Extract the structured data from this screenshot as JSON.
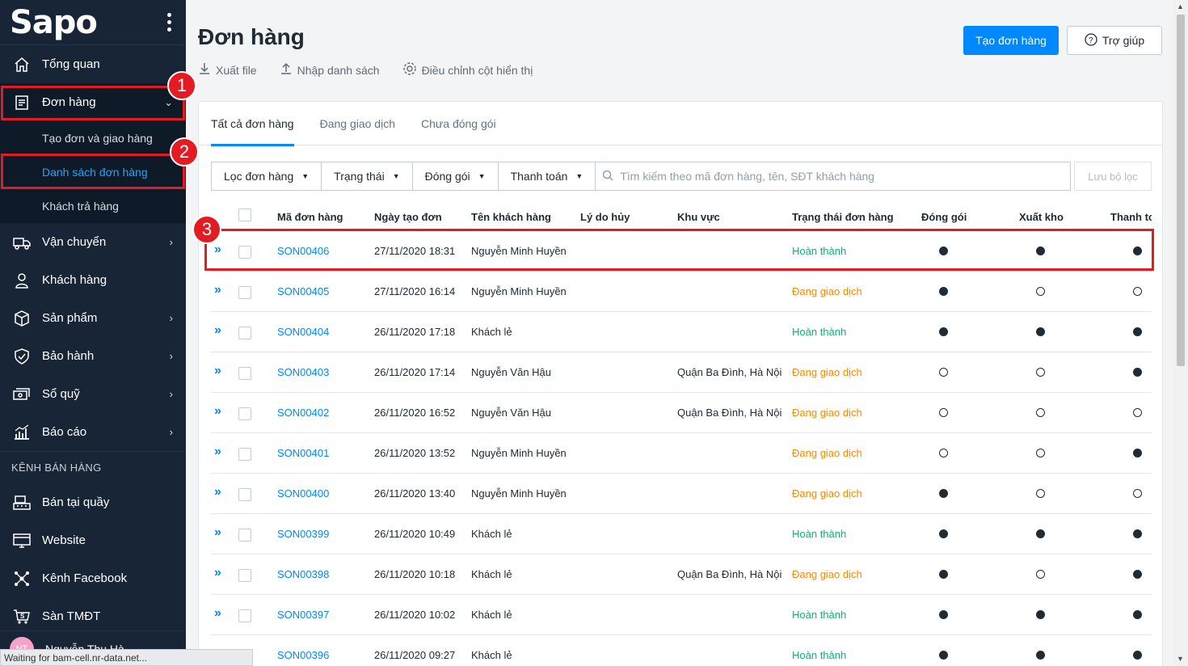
{
  "sidebar": {
    "logo": "Sapo",
    "items": [
      {
        "label": "Tổng quan",
        "icon": "home-icon",
        "chevron": ""
      },
      {
        "label": "Đơn hàng",
        "icon": "order-icon",
        "chevron": "⌄"
      },
      {
        "label": "Vận chuyển",
        "icon": "truck-icon",
        "chevron": "›"
      },
      {
        "label": "Khách hàng",
        "icon": "user-icon",
        "chevron": ""
      },
      {
        "label": "Sản phẩm",
        "icon": "box-icon",
        "chevron": "›"
      },
      {
        "label": "Bảo hành",
        "icon": "shield-icon",
        "chevron": "›"
      },
      {
        "label": "Sổ quỹ",
        "icon": "cash-icon",
        "chevron": "›"
      },
      {
        "label": "Báo cáo",
        "icon": "chart-icon",
        "chevron": "›"
      }
    ],
    "sub_items": [
      "Tạo đơn và giao hàng",
      "Danh sách đơn hàng",
      "Khách trả hàng"
    ],
    "channels_title": "KÊNH BÁN HÀNG",
    "channels": [
      {
        "label": "Bán tại quầy",
        "icon": "pos-icon"
      },
      {
        "label": "Website",
        "icon": "website-icon"
      },
      {
        "label": "Kênh Facebook",
        "icon": "facebook-icon"
      },
      {
        "label": "Sàn TMĐT",
        "icon": "marketplace-icon"
      }
    ],
    "user": {
      "initials": "NT",
      "name": "Nguyễn Thu Hà"
    }
  },
  "status_bar": "Waiting for bam-cell.nr-data.net...",
  "header": {
    "title": "Đơn hàng",
    "actions": [
      "Xuất file",
      "Nhập danh sách",
      "Điều chỉnh cột hiển thị"
    ],
    "create_button": "Tạo đơn hàng",
    "help_button": "Trợ giúp"
  },
  "tabs": [
    "Tất cả đơn hàng",
    "Đang giao dịch",
    "Chưa đóng gói"
  ],
  "filters": {
    "buttons": [
      "Lọc đơn hàng",
      "Trạng thái",
      "Đóng gói",
      "Thanh toán"
    ],
    "search_placeholder": "Tìm kiếm theo mã đơn hàng, tên, SĐT khách hàng",
    "save_filter": "Lưu bộ lọc"
  },
  "table": {
    "columns": [
      "Mã đơn hàng",
      "Ngày tạo đơn",
      "Tên khách hàng",
      "Lý do hủy",
      "Khu vực",
      "Trạng thái đơn hàng",
      "Đóng gói",
      "Xuất kho",
      "Thanh to"
    ],
    "rows": [
      {
        "code": "SON00406",
        "date": "27/11/2020 18:31",
        "customer": "Nguyễn Minh Huyền",
        "area": "",
        "status": "Hoàn thành",
        "packed": true,
        "exported": true,
        "paid": true
      },
      {
        "code": "SON00405",
        "date": "27/11/2020 16:14",
        "customer": "Nguyễn Minh Huyền",
        "area": "",
        "status": "Đang giao dịch",
        "packed": true,
        "exported": false,
        "paid": false
      },
      {
        "code": "SON00404",
        "date": "26/11/2020 17:18",
        "customer": "Khách lẻ",
        "area": "",
        "status": "Hoàn thành",
        "packed": true,
        "exported": true,
        "paid": true
      },
      {
        "code": "SON00403",
        "date": "26/11/2020 17:14",
        "customer": "Nguyễn Văn Hậu",
        "area": "Quận Ba Đình, Hà Nội",
        "status": "Đang giao dịch",
        "packed": false,
        "exported": false,
        "paid": true
      },
      {
        "code": "SON00402",
        "date": "26/11/2020 16:52",
        "customer": "Nguyễn Văn Hậu",
        "area": "Quận Ba Đình, Hà Nội",
        "status": "Đang giao dịch",
        "packed": false,
        "exported": false,
        "paid": false
      },
      {
        "code": "SON00401",
        "date": "26/11/2020 13:52",
        "customer": "Nguyễn Minh Huyền",
        "area": "",
        "status": "Đang giao dịch",
        "packed": false,
        "exported": false,
        "paid": true
      },
      {
        "code": "SON00400",
        "date": "26/11/2020 13:40",
        "customer": "Nguyễn Minh Huyền",
        "area": "",
        "status": "Đang giao dịch",
        "packed": true,
        "exported": false,
        "paid": false
      },
      {
        "code": "SON00399",
        "date": "26/11/2020 10:49",
        "customer": "Khách lẻ",
        "area": "",
        "status": "Hoàn thành",
        "packed": true,
        "exported": true,
        "paid": true
      },
      {
        "code": "SON00398",
        "date": "26/11/2020 10:18",
        "customer": "Khách lẻ",
        "area": "Quận Ba Đình, Hà Nội",
        "status": "Đang giao dịch",
        "packed": true,
        "exported": false,
        "paid": true
      },
      {
        "code": "SON00397",
        "date": "26/11/2020 10:02",
        "customer": "Khách lẻ",
        "area": "",
        "status": "Hoàn thành",
        "packed": true,
        "exported": true,
        "paid": true
      },
      {
        "code": "SON00396",
        "date": "26/11/2020 09:27",
        "customer": "Khách lẻ",
        "area": "",
        "status": "Hoàn thành",
        "packed": true,
        "exported": true,
        "paid": true
      }
    ]
  },
  "annotations": [
    "1",
    "2",
    "3"
  ],
  "colors": {
    "accent": "#0088ff",
    "sidebar": "#182537",
    "done": "#0db473",
    "dealing": "#ff8800",
    "marker": "#e31b23"
  }
}
